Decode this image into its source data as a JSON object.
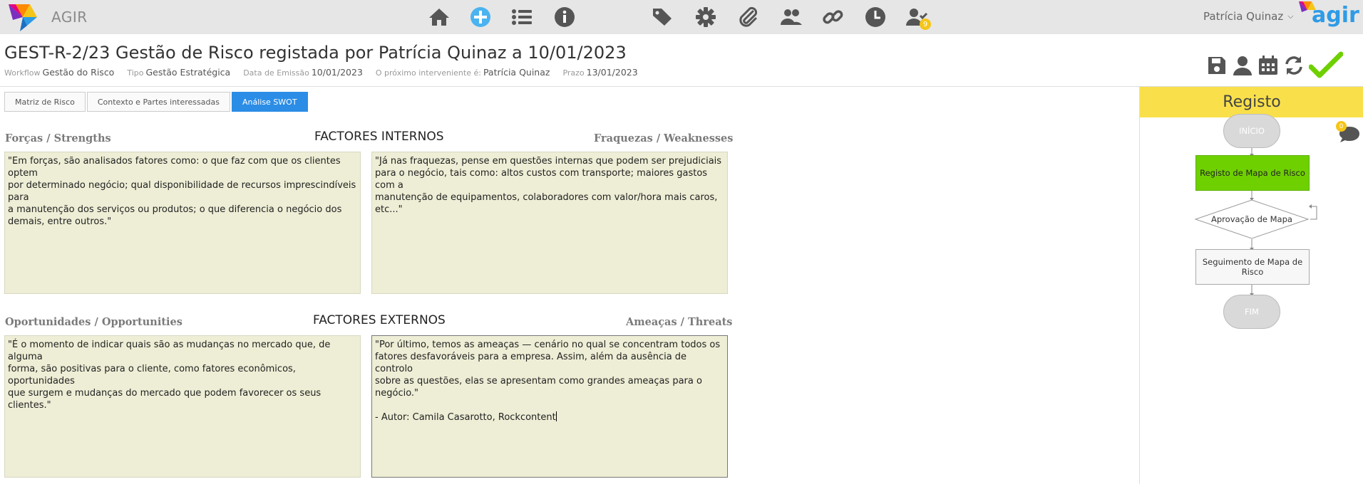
{
  "app": {
    "name": "AGIR",
    "user_name": "Patrícia Quinaz",
    "logo_right_text": "agir",
    "pending_badge": "9"
  },
  "nav": {
    "icons": [
      "home-icon",
      "add-icon",
      "list-icon",
      "info-icon",
      "tags-icon",
      "settings-icon",
      "attachment-icon",
      "users-icon",
      "link-icon",
      "clock-icon",
      "user-check-icon"
    ],
    "accent_color": "#4ab3f0"
  },
  "header": {
    "title": "GEST-R-2/23 Gestão de Risco registada por Patrícia Quinaz a 10/01/2023",
    "meta": {
      "workflow_label": "Workflow",
      "workflow_value": "Gestão do Risco",
      "tipo_label": "Tipo",
      "tipo_value": "Gestão Estratégica",
      "emissao_label": "Data de Emissão",
      "emissao_value": "10/01/2023",
      "interveniente_label": "O próximo interveniente é:",
      "interveniente_value": "Patrícia Quinaz",
      "prazo_label": "Prazo",
      "prazo_value": "13/01/2023"
    },
    "actions": [
      "save-icon",
      "user-icon",
      "calendar-icon",
      "refresh-icon",
      "check-icon"
    ],
    "check_color": "#6fd000"
  },
  "tabs": [
    {
      "label": "Matriz de Risco",
      "active": false
    },
    {
      "label": "Contexto e Partes interessadas",
      "active": false
    },
    {
      "label": "Análise SWOT",
      "active": true
    }
  ],
  "swot": {
    "internal_heading": "FACTORES INTERNOS",
    "external_heading": "FACTORES EXTERNOS",
    "strengths": {
      "label": "Forças / Strengths",
      "text": "\"Em forças, são analisados fatores como: o que faz com que os clientes optem\npor determinado negócio; qual disponibilidade de recursos imprescindíveis para\na manutenção dos serviços ou produtos; o que diferencia o negócio dos\ndemais, entre outros.\""
    },
    "weaknesses": {
      "label": "Fraquezas / Weaknesses",
      "text": "\"Já nas fraquezas, pense em questões internas que podem ser prejudiciais\npara o negócio, tais como: altos custos com transporte; maiores gastos com a\nmanutenção de equipamentos, colaboradores com valor/hora mais caros,\netc...\""
    },
    "opportunities": {
      "label": "Oportunidades / Opportunities",
      "text": "\"É o momento de indicar quais são as mudanças no mercado que, de alguma\nforma, são positivas para o cliente, como fatores econômicos, oportunidades\nque surgem e mudanças do mercado que podem favorecer os seus clientes.\""
    },
    "threats": {
      "label": "Ameaças / Threats",
      "text": "\"Por último, temos as ameaças — cenário no qual se concentram todos os\nfatores desfavoráveis para a empresa. Assim, além da ausência de controlo\nsobre as questões, elas se apresentam como grandes ameaças para o\nnegócio.\"\n\n- Autor: Camila Casarotto, Rockcontent"
    },
    "box_color": "#eeeed6"
  },
  "panel": {
    "title": "Registo",
    "title_bg": "#f9e04b",
    "comments_count": "0",
    "flow": {
      "start": "INÍCIO",
      "step1": "Registo de Mapa de Risco",
      "decision": "Aprovação de Mapa",
      "step2": "Seguimento de Mapa de Risco",
      "end": "FIM"
    }
  }
}
